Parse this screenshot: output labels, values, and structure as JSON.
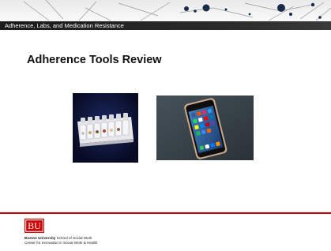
{
  "header": {
    "section_title": "Adherence, Labs, and Medication Resistance"
  },
  "slide": {
    "title": "Adherence Tools Review"
  },
  "images": [
    {
      "name": "pill-organizer-photo",
      "description": "weekly pill organizer box"
    },
    {
      "name": "smartphone-photo",
      "description": "smartphone home screen with app icons"
    }
  ],
  "footer": {
    "logo_text": "BU",
    "university": "Boston University",
    "school": " School of Social Work",
    "center": "Center for Innovation in Social Work & Health"
  },
  "colors": {
    "brand_red": "#cc0000",
    "header_bar": "#1b1b1b"
  }
}
